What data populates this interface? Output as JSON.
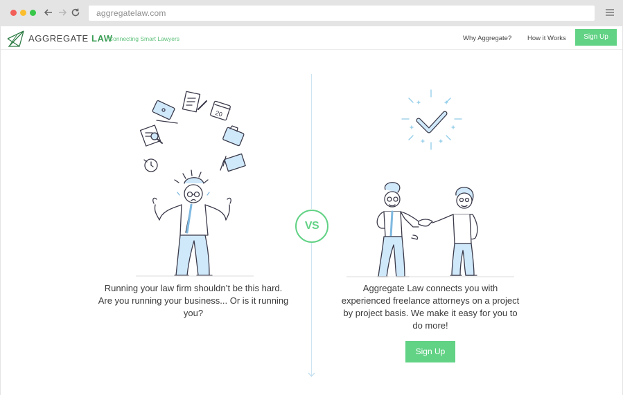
{
  "browser": {
    "url": "aggregatelaw.com",
    "icons": [
      "back-arrow-icon",
      "forward-arrow-icon",
      "reload-icon",
      "hamburger-menu-icon"
    ]
  },
  "header": {
    "logo_main": "AGGREGATE ",
    "logo_accent": "LAW",
    "tagline": "Connecting Smart Lawyers",
    "nav": {
      "why": "Why Aggregate?",
      "how": "How it Works",
      "signup": "Sign Up"
    }
  },
  "comparison": {
    "vs_label": "VS",
    "left_text": "Running your law firm shouldn’t be this hard. Are you running your business... Or is it running you?",
    "right_text": "Aggregate Law connects you with experienced freelance attorneys on a project by project basis. We make it easy for you to do more!",
    "cta": "Sign Up",
    "calendar_number": "20"
  },
  "colors": {
    "accent_green": "#62d285",
    "logo_green": "#3c9d55",
    "illustration_blue": "#cfe8fa",
    "line_color": "#3a3a4a",
    "divider_blue": "#cde4f2"
  }
}
